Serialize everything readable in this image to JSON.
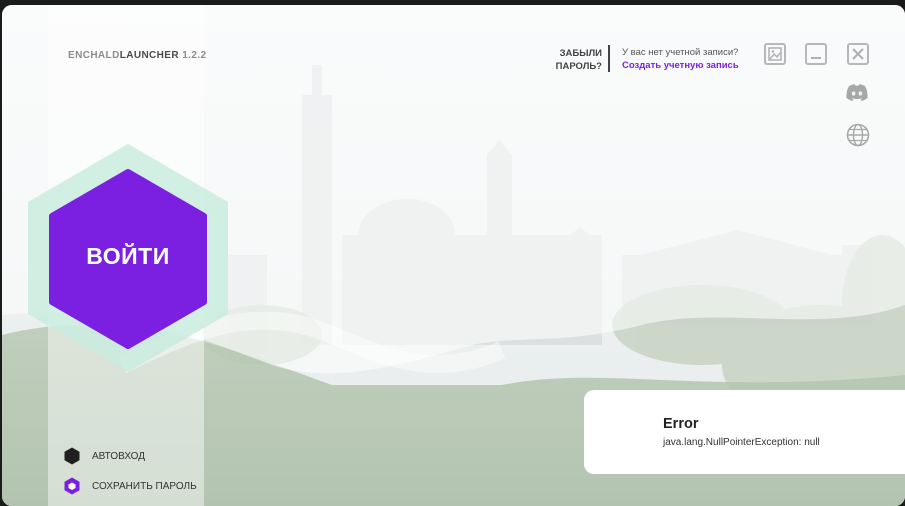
{
  "app": {
    "name_part1": "ENCHALD",
    "name_part2": "LAUNCHER",
    "version": "1.2.2"
  },
  "login_button": {
    "label": "ВОЙТИ"
  },
  "options": {
    "autologin": "АВТОВХОД",
    "save_password": "СОХРАНИТЬ ПАРОЛЬ"
  },
  "account": {
    "forgot_line1": "ЗАБЫЛИ",
    "forgot_line2": "ПАРОЛЬ?",
    "no_account": "У вас нет учетной записи?",
    "create_account": "Создать учетную запись"
  },
  "error": {
    "title": "Error",
    "message": "java.lang.NullPointerException: null"
  },
  "colors": {
    "accent": "#7b1fe0",
    "hex_glow": "#c9ecde",
    "text_dark": "#333333"
  },
  "icons": [
    "settings-image-icon",
    "minimize-icon",
    "close-icon",
    "discord-icon",
    "globe-icon"
  ]
}
